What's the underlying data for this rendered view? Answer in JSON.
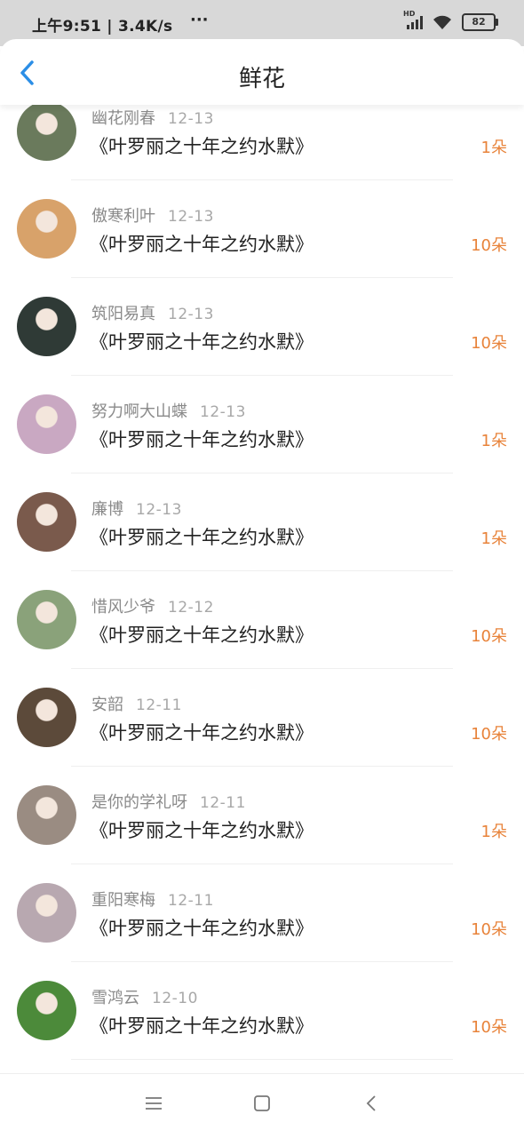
{
  "status": {
    "time_speed": "上午9:51 | 3.4K/s",
    "dots": "···",
    "hd": "HD",
    "battery": "82"
  },
  "header": {
    "title": "鲜花"
  },
  "rows": [
    {
      "user": "幽花刚春",
      "date": "12-13",
      "book": "《叶罗丽之十年之约水默》",
      "count": "1朵",
      "avatar_color": "#6a7a5c"
    },
    {
      "user": "傲寒利叶",
      "date": "12-13",
      "book": "《叶罗丽之十年之约水默》",
      "count": "10朵",
      "avatar_color": "#d8a26a"
    },
    {
      "user": "筑阳易真",
      "date": "12-13",
      "book": "《叶罗丽之十年之约水默》",
      "count": "10朵",
      "avatar_color": "#2f3a36"
    },
    {
      "user": "努力啊大山蝶",
      "date": "12-13",
      "book": "《叶罗丽之十年之约水默》",
      "count": "1朵",
      "avatar_color": "#c9a8c2"
    },
    {
      "user": "廉博",
      "date": "12-13",
      "book": "《叶罗丽之十年之约水默》",
      "count": "1朵",
      "avatar_color": "#7a5a4c"
    },
    {
      "user": "惜风少爷",
      "date": "12-12",
      "book": "《叶罗丽之十年之约水默》",
      "count": "10朵",
      "avatar_color": "#8aa27a"
    },
    {
      "user": "安韶",
      "date": "12-11",
      "book": "《叶罗丽之十年之约水默》",
      "count": "10朵",
      "avatar_color": "#5c4a3a"
    },
    {
      "user": "是你的学礼呀",
      "date": "12-11",
      "book": "《叶罗丽之十年之约水默》",
      "count": "1朵",
      "avatar_color": "#9a8c82"
    },
    {
      "user": "重阳寒梅",
      "date": "12-11",
      "book": "《叶罗丽之十年之约水默》",
      "count": "10朵",
      "avatar_color": "#b8a8b0"
    },
    {
      "user": "雪鸿云",
      "date": "12-10",
      "book": "《叶罗丽之十年之约水默》",
      "count": "10朵",
      "avatar_color": "#4c8a3a"
    }
  ],
  "colors": {
    "accent": "#2b8ee6",
    "count": "#e8833a"
  }
}
